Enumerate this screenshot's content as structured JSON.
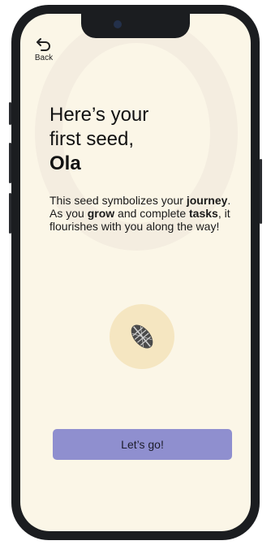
{
  "nav": {
    "back_label": "Back"
  },
  "onboarding": {
    "title_line1": "Here’s your",
    "title_line2": "first seed,",
    "user_name": "Ola",
    "desc_part1": "This seed symbolizes your ",
    "desc_bold1": "journey",
    "desc_part2": ". As you ",
    "desc_bold2": "grow",
    "desc_part3": " and complete ",
    "desc_bold3": "tasks",
    "desc_part4": ", it flourishes with you along the way!",
    "seed_icon": "cocoa-seed-icon",
    "cta_label": "Let’s go!"
  },
  "colors": {
    "background": "#fbf6e7",
    "seed_circle": "#f5e6c1",
    "button": "#8f8fcf",
    "text": "#121212"
  }
}
